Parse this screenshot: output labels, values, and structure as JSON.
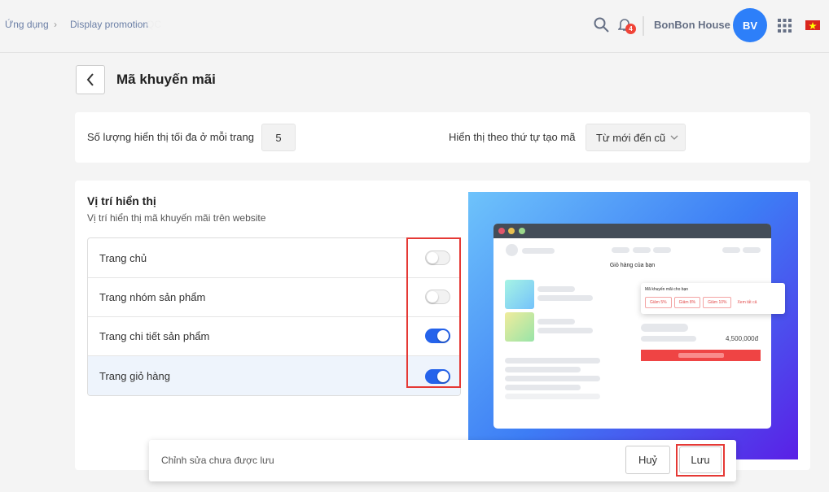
{
  "breadcrumb": [
    "Ứng dụng",
    "Display promotion",
    "QC"
  ],
  "header": {
    "shop_name": "BonBon House",
    "avatar_initials": "BV",
    "notification_count": "4"
  },
  "page": {
    "title": "Mã khuyến mãi"
  },
  "settings": {
    "max_label": "Số lượng hiển thị tối đa ở mỗi trang",
    "max_value": "5",
    "order_label": "Hiển thị theo thứ tự tạo mã",
    "order_value": "Từ mới đến cũ"
  },
  "position": {
    "title": "Vị trí hiển thị",
    "subtitle": "Vị trí hiển thị mã khuyến mãi trên website",
    "items": [
      {
        "label": "Trang chủ",
        "on": false
      },
      {
        "label": "Trang nhóm sản phẩm",
        "on": false
      },
      {
        "label": "Trang chi tiết sản phẩm",
        "on": true
      },
      {
        "label": "Trang giỏ hàng",
        "on": true
      }
    ]
  },
  "preview": {
    "cart_title": "Giỏ hàng của bạn",
    "promo_title": "Mã khuyến mãi cho bạn",
    "coupons": [
      "Giảm 5%",
      "Giảm 8%",
      "Giảm 10%"
    ],
    "see_all": "Xem tất cả",
    "total": "4,500,000đ"
  },
  "footer": {
    "message": "Chỉnh sửa chưa được lưu",
    "cancel": "Huỷ",
    "save": "Lưu"
  },
  "colors": {
    "accent": "#2563eb",
    "highlight": "#e53935"
  }
}
